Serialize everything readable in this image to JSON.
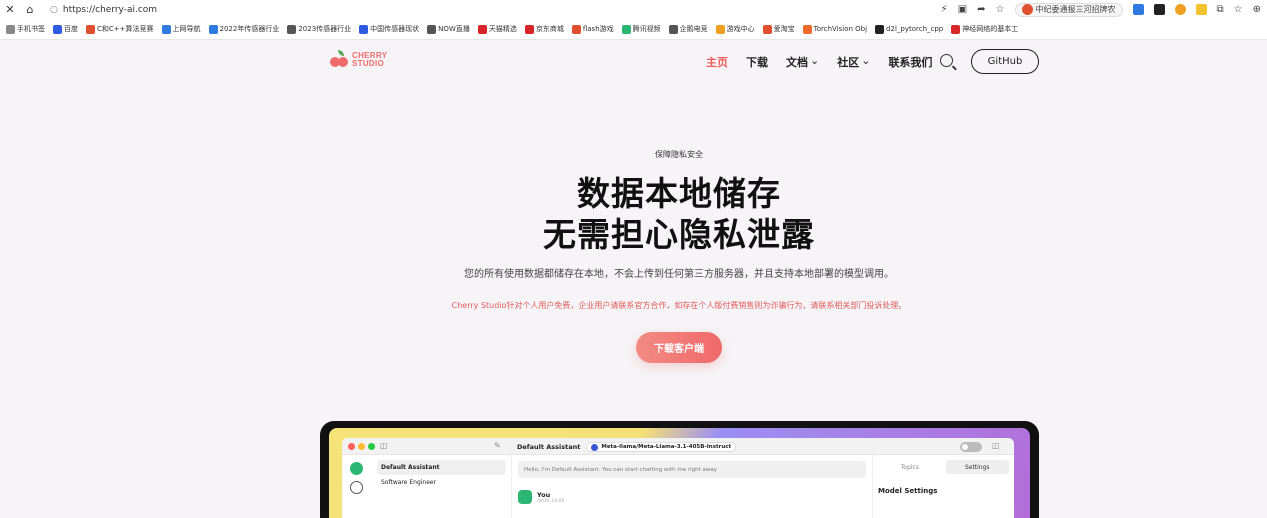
{
  "browser": {
    "nav": {
      "close": "✕",
      "home": "⌂"
    },
    "url": "https://cherry-ai.com",
    "extension_pill": "中纪委通报三河招牌农",
    "bookmarks": [
      {
        "label": "手机书签",
        "color": "#888888"
      },
      {
        "label": "百度",
        "color": "#2f5be0"
      },
      {
        "label": "C和C++算法竞赛",
        "color": "#e0502f"
      },
      {
        "label": "上网导航",
        "color": "#2f7ae0"
      },
      {
        "label": "2022年传感器行业",
        "color": "#2f7ae0"
      },
      {
        "label": "2023传感器行业",
        "color": "#555555"
      },
      {
        "label": "中国传感器现状",
        "color": "#2f5be0"
      },
      {
        "label": "NOW直播",
        "color": "#555555"
      },
      {
        "label": "天猫精选",
        "color": "#d6262a"
      },
      {
        "label": "京东商城",
        "color": "#d6262a"
      },
      {
        "label": "flash游戏",
        "color": "#e0502f"
      },
      {
        "label": "腾讯视频",
        "color": "#2bb673"
      },
      {
        "label": "企鹅电竞",
        "color": "#555555"
      },
      {
        "label": "游戏中心",
        "color": "#f0a020"
      },
      {
        "label": "爱淘宝",
        "color": "#e0502f"
      },
      {
        "label": "TorchVision Obj",
        "color": "#ee6a2a"
      },
      {
        "label": "d2l_pytorch_cpp",
        "color": "#222222"
      },
      {
        "label": "神经网络的基本工",
        "color": "#d6262a"
      }
    ]
  },
  "header": {
    "logo_line1": "CHERRY",
    "logo_line2": "STUDIO",
    "nav": [
      "主页",
      "下载",
      "文档",
      "社区",
      "联系我们"
    ],
    "github": "GitHub"
  },
  "hero": {
    "eyebrow": "保障隐私安全",
    "title_line1": "数据本地储存",
    "title_line2": "无需担心隐私泄露",
    "description": "您的所有使用数据都储存在本地，不会上传到任何第三方服务器，并且支持本地部署的模型调用。",
    "notice": "Cherry Studio针对个人用户免费，企业用户请联系官方合作，如存在个人版付费销售则为诈骗行为，请联系相关部门投诉处理。",
    "download": "下载客户端"
  },
  "app_preview": {
    "title": "Default Assistant",
    "model": "Meta-llama/Meta-Llama-3.1-405B-Instruct",
    "assistants": [
      "Default Assistant",
      "Software Engineer"
    ],
    "hello": "Hello, I'm Default Assistant. You can start chatting with me right away",
    "user_name": "You",
    "user_time": "09/26 14:00",
    "tabs": [
      "Topics",
      "Settings"
    ],
    "settings_heading": "Model Settings"
  },
  "colors": {
    "accent": "#ef5a5a",
    "background": "#f6f4f6"
  }
}
